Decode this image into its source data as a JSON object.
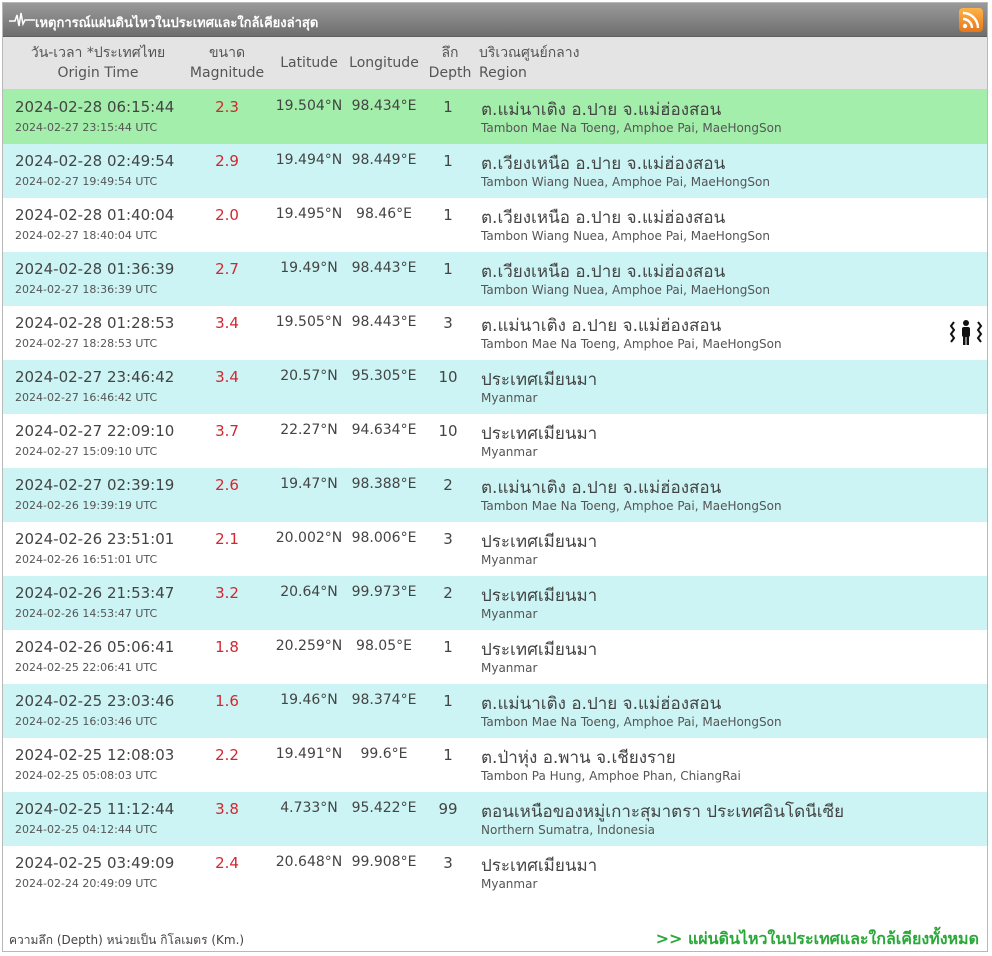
{
  "window": {
    "title": "เหตุการณ์แผ่นดินไหวในประเทศและใกล้เคียงล่าสุด",
    "rss_icon": "rss-icon"
  },
  "header": {
    "time_th": "วัน-เวลา *ประเทศไทย",
    "time_en": "Origin Time",
    "mag_th": "ขนาด",
    "mag_en": "Magnitude",
    "lat": "Latitude",
    "lon": "Longitude",
    "depth_th": "ลึก",
    "depth_en": "Depth",
    "region_th": "บริเวณศูนย์กลาง",
    "region_en": "Region"
  },
  "rows": [
    {
      "time": "2024-02-28 06:15:44",
      "utc": "2024-02-27 23:15:44 UTC",
      "mag": "2.3",
      "lat": "19.504°N",
      "lon": "98.434°E",
      "depth": "1",
      "region_th": "ต.แม่นาเติง อ.ปาย จ.แม่ฮ่องสอน",
      "region_en": "Tambon Mae Na Toeng, Amphoe Pai, MaeHongSon"
    },
    {
      "time": "2024-02-28 02:49:54",
      "utc": "2024-02-27 19:49:54 UTC",
      "mag": "2.9",
      "lat": "19.494°N",
      "lon": "98.449°E",
      "depth": "1",
      "region_th": "ต.เวียงเหนือ อ.ปาย จ.แม่ฮ่องสอน",
      "region_en": "Tambon Wiang Nuea, Amphoe Pai, MaeHongSon"
    },
    {
      "time": "2024-02-28 01:40:04",
      "utc": "2024-02-27 18:40:04 UTC",
      "mag": "2.0",
      "lat": "19.495°N",
      "lon": "98.46°E",
      "depth": "1",
      "region_th": "ต.เวียงเหนือ อ.ปาย จ.แม่ฮ่องสอน",
      "region_en": "Tambon Wiang Nuea, Amphoe Pai, MaeHongSon"
    },
    {
      "time": "2024-02-28 01:36:39",
      "utc": "2024-02-27 18:36:39 UTC",
      "mag": "2.7",
      "lat": "19.49°N",
      "lon": "98.443°E",
      "depth": "1",
      "region_th": "ต.เวียงเหนือ อ.ปาย จ.แม่ฮ่องสอน",
      "region_en": "Tambon Wiang Nuea, Amphoe Pai, MaeHongSon"
    },
    {
      "time": "2024-02-28 01:28:53",
      "utc": "2024-02-27 18:28:53 UTC",
      "mag": "3.4",
      "lat": "19.505°N",
      "lon": "98.443°E",
      "depth": "3",
      "region_th": "ต.แม่นาเติง อ.ปาย จ.แม่ฮ่องสอน",
      "region_en": "Tambon Mae Na Toeng, Amphoe Pai, MaeHongSon"
    },
    {
      "time": "2024-02-27 23:46:42",
      "utc": "2024-02-27 16:46:42 UTC",
      "mag": "3.4",
      "lat": "20.57°N",
      "lon": "95.305°E",
      "depth": "10",
      "region_th": "ประเทศเมียนมา",
      "region_en": "Myanmar"
    },
    {
      "time": "2024-02-27 22:09:10",
      "utc": "2024-02-27 15:09:10 UTC",
      "mag": "3.7",
      "lat": "22.27°N",
      "lon": "94.634°E",
      "depth": "10",
      "region_th": "ประเทศเมียนมา",
      "region_en": "Myanmar"
    },
    {
      "time": "2024-02-27 02:39:19",
      "utc": "2024-02-26 19:39:19 UTC",
      "mag": "2.6",
      "lat": "19.47°N",
      "lon": "98.388°E",
      "depth": "2",
      "region_th": "ต.แม่นาเติง อ.ปาย จ.แม่ฮ่องสอน",
      "region_en": "Tambon Mae Na Toeng, Amphoe Pai, MaeHongSon"
    },
    {
      "time": "2024-02-26 23:51:01",
      "utc": "2024-02-26 16:51:01 UTC",
      "mag": "2.1",
      "lat": "20.002°N",
      "lon": "98.006°E",
      "depth": "3",
      "region_th": "ประเทศเมียนมา",
      "region_en": "Myanmar"
    },
    {
      "time": "2024-02-26 21:53:47",
      "utc": "2024-02-26 14:53:47 UTC",
      "mag": "3.2",
      "lat": "20.64°N",
      "lon": "99.973°E",
      "depth": "2",
      "region_th": "ประเทศเมียนมา",
      "region_en": "Myanmar"
    },
    {
      "time": "2024-02-26 05:06:41",
      "utc": "2024-02-25 22:06:41 UTC",
      "mag": "1.8",
      "lat": "20.259°N",
      "lon": "98.05°E",
      "depth": "1",
      "region_th": "ประเทศเมียนมา",
      "region_en": "Myanmar"
    },
    {
      "time": "2024-02-25 23:03:46",
      "utc": "2024-02-25 16:03:46 UTC",
      "mag": "1.6",
      "lat": "19.46°N",
      "lon": "98.374°E",
      "depth": "1",
      "region_th": "ต.แม่นาเติง อ.ปาย จ.แม่ฮ่องสอน",
      "region_en": "Tambon Mae Na Toeng, Amphoe Pai, MaeHongSon"
    },
    {
      "time": "2024-02-25 12:08:03",
      "utc": "2024-02-25 05:08:03 UTC",
      "mag": "2.2",
      "lat": "19.491°N",
      "lon": "99.6°E",
      "depth": "1",
      "region_th": "ต.ป่าหุ่ง อ.พาน จ.เชียงราย",
      "region_en": "Tambon Pa Hung, Amphoe Phan, ChiangRai"
    },
    {
      "time": "2024-02-25 11:12:44",
      "utc": "2024-02-25 04:12:44 UTC",
      "mag": "3.8",
      "lat": "4.733°N",
      "lon": "95.422°E",
      "depth": "99",
      "region_th": "ตอนเหนือของหมู่เกาะสุมาตรา ประเทศอินโดนีเซีย",
      "region_en": "Northern Sumatra, Indonesia"
    },
    {
      "time": "2024-02-25 03:49:09",
      "utc": "2024-02-24 20:49:09 UTC",
      "mag": "2.4",
      "lat": "20.648°N",
      "lon": "99.908°E",
      "depth": "3",
      "region_th": "ประเทศเมียนมา",
      "region_en": "Myanmar"
    }
  ],
  "felt_icon_row": 4,
  "felt_icon": "people-felt-icon",
  "footer": {
    "note": "ความลึก (Depth) หน่วยเป็น กิโลเมตร (Km.)",
    "link": ">> แผ่นดินไหวในประเทศและใกล้เคียงทั้งหมด"
  },
  "colors": {
    "first_row": "#a3eeaa",
    "alt_row": "#ccf4f4",
    "magnitude": "#d4262f",
    "link": "#2aa83a"
  }
}
